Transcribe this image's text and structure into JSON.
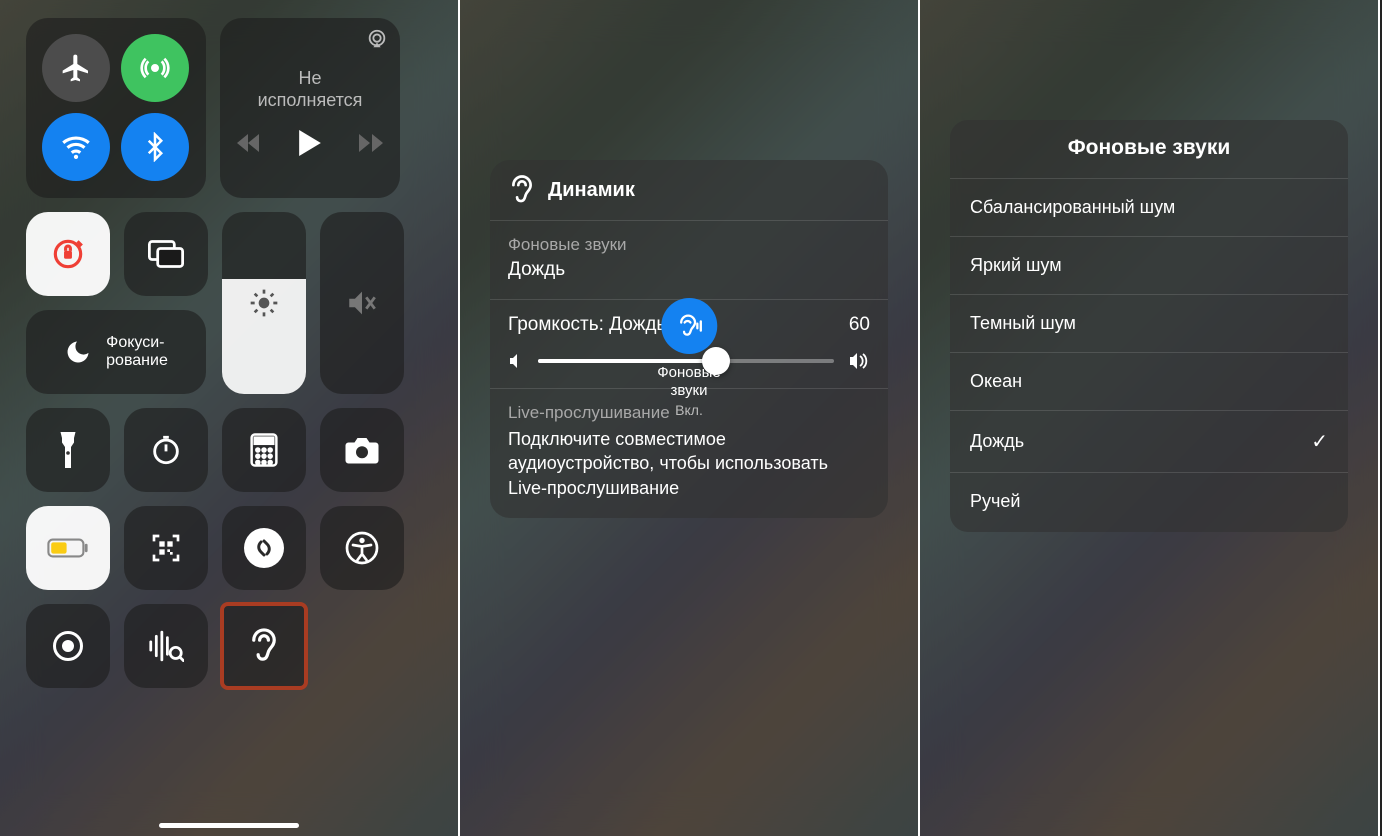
{
  "screen1": {
    "media": {
      "title_line1": "Не",
      "title_line2": "исполняется"
    },
    "focus": {
      "line1": "Фокуси-",
      "line2": "рование"
    },
    "icons": {
      "airplane": "airplane-icon",
      "cellular": "cellular-icon",
      "wifi": "wifi-icon",
      "bluetooth": "bluetooth-icon",
      "airplay": "airplay-icon",
      "back": "back-icon",
      "play": "play-icon",
      "forward": "forward-icon",
      "rotation_lock": "rotation-lock-icon",
      "screen_mirror": "screen-mirror-icon",
      "moon": "moon-icon",
      "sun": "sun-icon",
      "mute": "mute-icon",
      "flashlight": "flashlight-icon",
      "timer": "timer-icon",
      "calculator": "calculator-icon",
      "camera": "camera-icon",
      "low_power": "low-power-icon",
      "qr": "qr-icon",
      "shazam": "shazam-icon",
      "accessibility": "accessibility-icon",
      "record": "record-icon",
      "sound_recognition": "sound-recognition-icon",
      "hearing": "hearing-icon"
    }
  },
  "screen2": {
    "header": "Динамик",
    "section1_label": "Фоновые звуки",
    "section1_value": "Дождь",
    "volume_label": "Громкость: Дождь",
    "volume_value": "60",
    "live_label": "Live-прослушивание",
    "live_body": "Подключите совместимое аудиоустройство, чтобы использовать Live-прослушивание",
    "button_label_line1": "Фоновые",
    "button_label_line2": "звуки",
    "button_status": "Вкл."
  },
  "screen3": {
    "title": "Фоновые звуки",
    "items": [
      {
        "label": "Сбалансированный шум",
        "checked": false
      },
      {
        "label": "Яркий шум",
        "checked": false
      },
      {
        "label": "Темный шум",
        "checked": false
      },
      {
        "label": "Океан",
        "checked": false
      },
      {
        "label": "Дождь",
        "checked": true
      },
      {
        "label": "Ручей",
        "checked": false
      }
    ]
  }
}
